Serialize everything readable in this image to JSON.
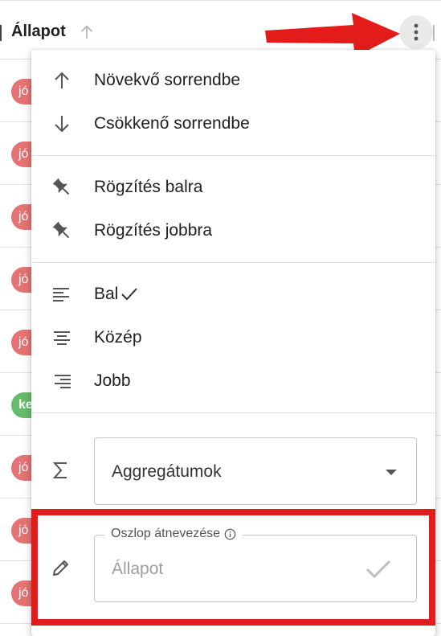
{
  "colors": {
    "chip_red": "#e57373",
    "chip_green": "#66bb6a",
    "annotation_red": "#e41b1b",
    "menu_bg": "#ffffff"
  },
  "grid": {
    "column_title": "Állapot",
    "rows": [
      {
        "chip": "jó",
        "color": "red"
      },
      {
        "chip": "jó",
        "color": "red"
      },
      {
        "chip": "jó",
        "color": "red"
      },
      {
        "chip": "jó",
        "color": "red"
      },
      {
        "chip": "jó",
        "color": "red"
      },
      {
        "chip": "ke",
        "color": "green"
      },
      {
        "chip": "jó",
        "color": "red"
      },
      {
        "chip": "jó",
        "color": "red"
      },
      {
        "chip": "jó",
        "color": "red"
      }
    ]
  },
  "menu": {
    "sort_asc": "Növekvő sorrendbe",
    "sort_desc": "Csökkenő sorrendbe",
    "pin_left": "Rögzítés balra",
    "pin_right": "Rögzítés jobbra",
    "align_left": "Bal",
    "align_center": "Közép",
    "align_right": "Jobb",
    "aggregate_value": "Aggregátumok",
    "rename_label": "Oszlop átnevezése",
    "rename_placeholder": "Állapot"
  },
  "icons": {
    "sort": "arrow-up-icon",
    "menu": "more-vert-icon",
    "sort_asc": "arrow-up-icon",
    "sort_desc": "arrow-down-icon",
    "pin_left": "pin-icon",
    "pin_right": "pin-icon",
    "align_left": "align-left-icon",
    "align_center": "align-center-icon",
    "align_right": "align-right-icon",
    "aggregate": "sigma-icon",
    "rename": "pencil-icon",
    "info": "info-icon",
    "confirm": "check-icon"
  }
}
